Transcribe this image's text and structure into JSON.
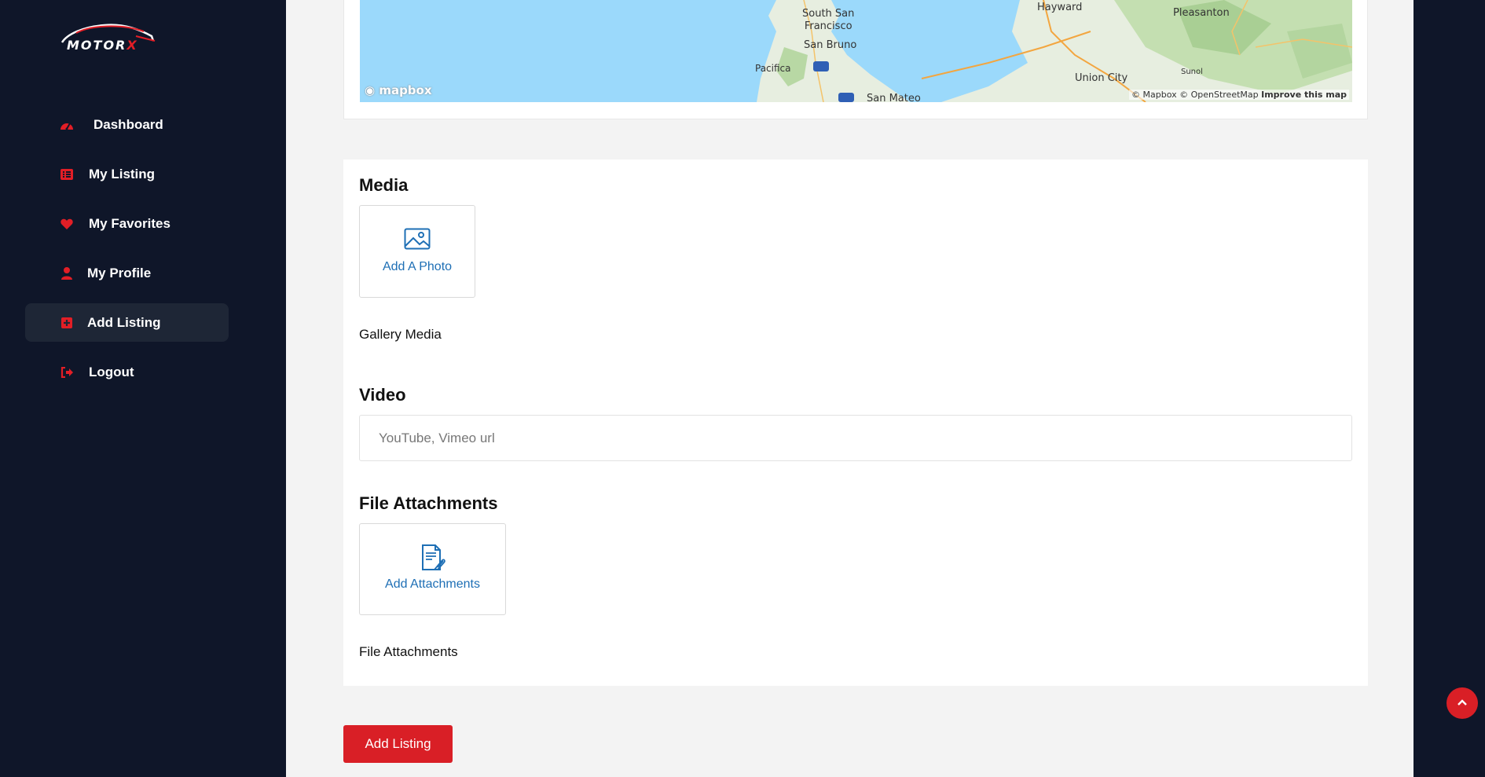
{
  "brand": {
    "logo_text_main": "MOTOR",
    "logo_text_accent": "X",
    "accent_color": "#e21e26"
  },
  "sidebar": {
    "items": [
      {
        "label": "Dashboard",
        "icon": "speedometer-icon",
        "active": false
      },
      {
        "label": "My Listing",
        "icon": "list-icon",
        "active": false
      },
      {
        "label": "My Favorites",
        "icon": "heart-icon",
        "active": false
      },
      {
        "label": "My Profile",
        "icon": "user-icon",
        "active": false
      },
      {
        "label": "Add Listing",
        "icon": "plus-square-icon",
        "active": true
      },
      {
        "label": "Logout",
        "icon": "logout-icon",
        "active": false
      }
    ]
  },
  "map": {
    "labels": {
      "south_san_francisco": "South San\nFrancisco",
      "san_bruno": "San Bruno",
      "pacifica": "Pacifica",
      "hayward": "Hayward",
      "pleasanton": "Pleasanton",
      "union_city": "Union City",
      "sunol": "Sunol",
      "san_mateo": "San Mateo"
    },
    "mapbox_logo": "mapbox",
    "attribution": "© Mapbox © OpenStreetMap",
    "improve_link": "Improve this map"
  },
  "media": {
    "title": "Media",
    "add_photo_label": "Add A Photo",
    "gallery_label": "Gallery Media"
  },
  "video": {
    "title": "Video",
    "placeholder": "YouTube, Vimeo url",
    "value": ""
  },
  "attachments": {
    "title": "File Attachments",
    "add_label": "Add Attachments",
    "list_label": "File Attachments"
  },
  "submit": {
    "label": "Add Listing"
  }
}
